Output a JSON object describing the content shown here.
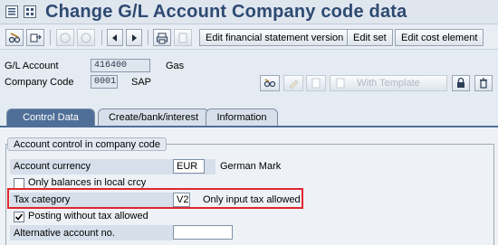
{
  "window": {
    "title": "Change G/L Account Company code data"
  },
  "toolbar": {
    "buttons": [
      {
        "name": "switch-display-change-button",
        "icon": "pencil-glasses-icon"
      },
      {
        "name": "other-account-button",
        "icon": "other-object-icon"
      },
      {
        "name": "previous-entry-button",
        "icon": "arrow-up-icon"
      },
      {
        "name": "next-entry-button",
        "icon": "arrow-down-icon"
      },
      {
        "name": "first-page-button",
        "icon": "triangle-left-icon"
      },
      {
        "name": "next-page-button",
        "icon": "triangle-right-icon"
      },
      {
        "name": "print-button",
        "icon": "printer-icon"
      },
      {
        "name": "info-button",
        "icon": "document-icon"
      }
    ],
    "edit_fs_version": "Edit financial statement version",
    "edit_set": "Edit set",
    "edit_cost_element": "Edit cost element"
  },
  "header": {
    "gl_account_label": "G/L Account",
    "gl_account_value": "416400",
    "gl_account_desc": "Gas",
    "company_code_label": "Company Code",
    "company_code_value": "0001",
    "company_code_desc": "SAP",
    "with_template_label": "With Template"
  },
  "tabs": [
    {
      "label": "Control Data",
      "active": true
    },
    {
      "label": "Create/bank/interest",
      "active": false
    },
    {
      "label": "Information",
      "active": false
    }
  ],
  "control_group": {
    "title": "Account control in company code",
    "account_currency_label": "Account currency",
    "account_currency_value": "EUR",
    "account_currency_desc": "German Mark",
    "only_balances_label": "Only balances in local crcy",
    "only_balances_checked": false,
    "tax_category_label": "Tax category",
    "tax_category_value": "V2",
    "tax_category_desc": "Only input tax allowed",
    "posting_without_tax_label": "Posting without tax allowed",
    "posting_without_tax_checked": true,
    "alt_account_label": "Alternative account no.",
    "alt_account_value": ""
  },
  "colors": {
    "title_text": "#2e4a72",
    "active_tab": "#4f6f98",
    "highlight": "#e0262e"
  }
}
